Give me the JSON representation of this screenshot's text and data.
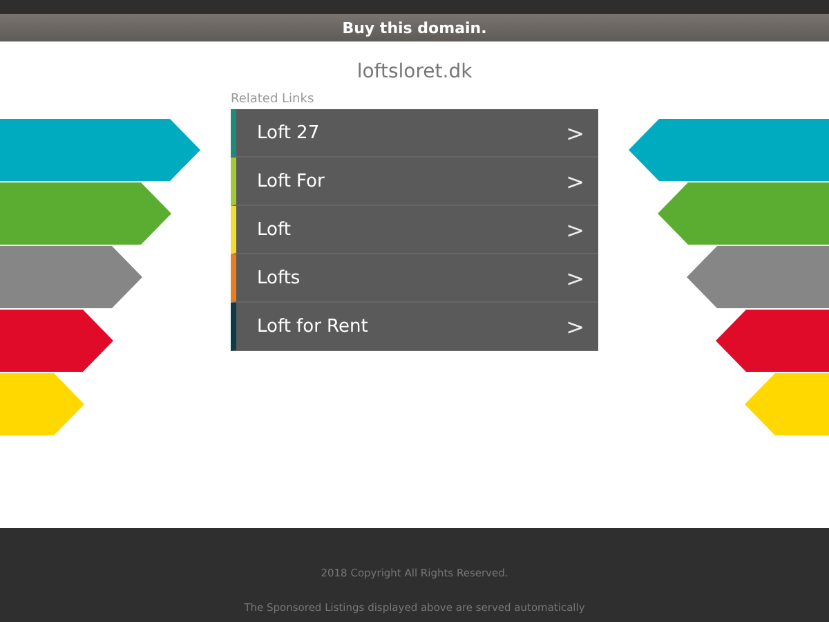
{
  "banner": {
    "label": "Buy this domain."
  },
  "domain": "loftsloret.dk",
  "related_links": {
    "heading": "Related Links",
    "items": [
      {
        "label": "Loft 27",
        "icon": ">",
        "color": "#1f8a7a"
      },
      {
        "label": "Loft For",
        "icon": ">",
        "color": "#a5c83a"
      },
      {
        "label": "Loft",
        "icon": ">",
        "color": "#f2dc2f"
      },
      {
        "label": "Lofts",
        "icon": ">",
        "color": "#e67e22"
      },
      {
        "label": "Loft for Rent",
        "icon": ">",
        "color": "#0d3b4a"
      }
    ]
  },
  "footer": {
    "copyright": "2018 Copyright All Rights Reserved.",
    "notice": "The Sponsored Listings displayed above are served automatically"
  }
}
